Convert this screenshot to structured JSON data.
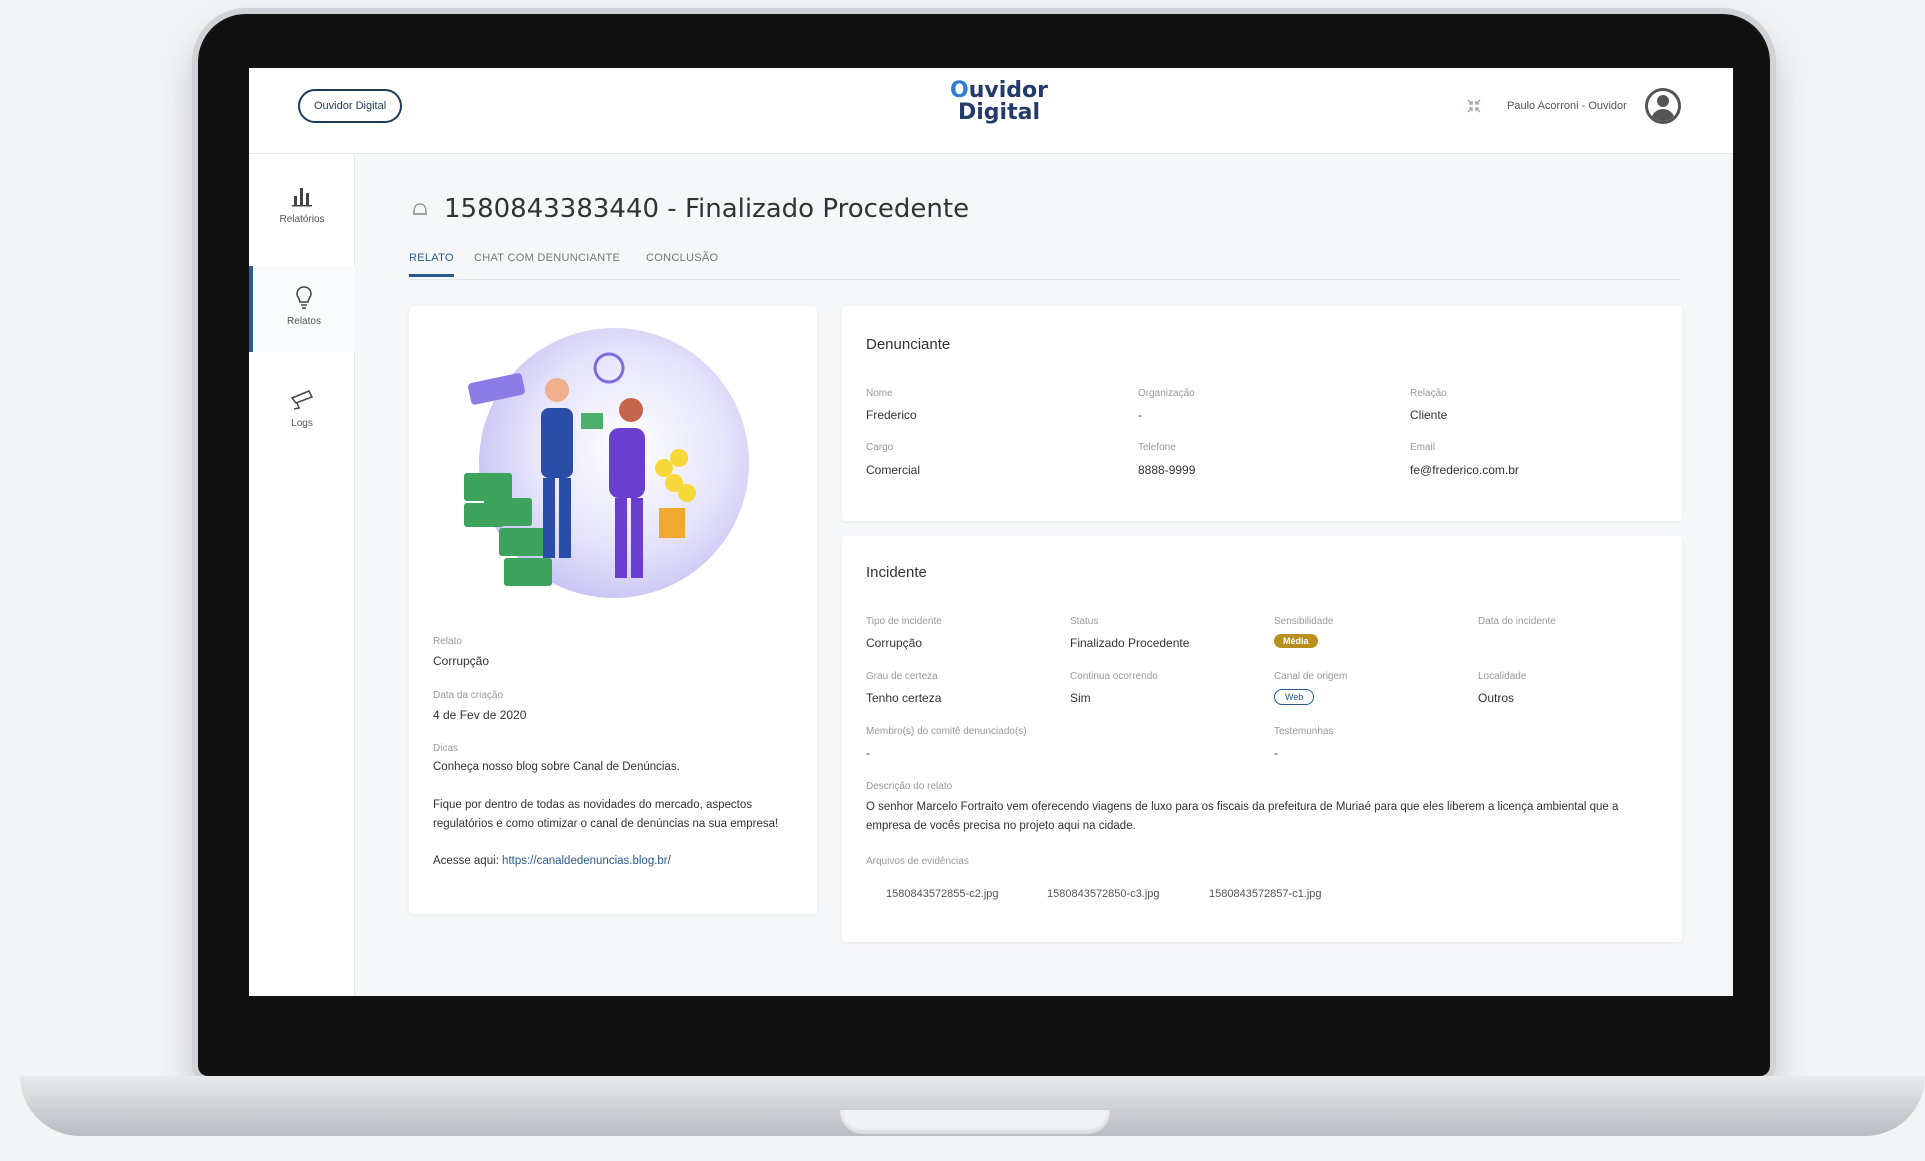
{
  "header": {
    "brand_pill": "Ouvidor Digital",
    "logo_line1_o": "O",
    "logo_line1_rest": "uvidor",
    "logo_line2": "Digital",
    "user": "Paulo Acorroni - Ouvidor"
  },
  "sidebar": {
    "items": [
      {
        "label": "Relatórios",
        "icon": "bar-chart-icon"
      },
      {
        "label": "Relatos",
        "icon": "lightbulb-icon"
      },
      {
        "label": "Logs",
        "icon": "camera-icon"
      }
    ]
  },
  "page": {
    "title": "1580843383440 - Finalizado Procedente",
    "tabs": [
      "RELATO",
      "CHAT COM DENUNCIANTE",
      "CONCLUSÃO"
    ]
  },
  "left_card": {
    "relato_label": "Relato",
    "relato_value": "Corrupção",
    "data_label": "Data da criação",
    "data_value": "4 de Fev de 2020",
    "dicas_label": "Dicas",
    "dicas_line1": "Conheça nosso blog sobre Canal de Denúncias.",
    "dicas_line2": "Fique por dentro de todas as novidades do mercado, aspectos",
    "dicas_line3": "regulatórios e como otimizar o canal de denúncias na sua empresa!",
    "access_prefix": "Acesse aqui: ",
    "access_link": "https://canaldedenuncias.blog.br/"
  },
  "denunciante": {
    "title": "Denunciante",
    "nome_label": "Nome",
    "nome": "Frederico",
    "org_label": "Organização",
    "org": "-",
    "relacao_label": "Relação",
    "relacao": "Cliente",
    "cargo_label": "Cargo",
    "cargo": "Comercial",
    "telefone_label": "Telefone",
    "telefone": "8888-9999",
    "email_label": "Email",
    "email": "fe@frederico.com.br"
  },
  "incidente": {
    "title": "Incidente",
    "tipo_label": "Tipo de incidente",
    "tipo": "Corrupção",
    "status_label": "Status",
    "status": "Finalizado Procedente",
    "sens_label": "Sensibilidade",
    "sens": "Média",
    "data_label": "Data do incidente",
    "grau_label": "Grau de certeza",
    "grau": "Tenho certeza",
    "continua_label": "Continua ocorrendo",
    "continua": "Sim",
    "canal_label": "Canal de origem",
    "canal": "Web",
    "local_label": "Localidade",
    "local": "Outros",
    "membros_label": "Membro(s) do comitê denunciado(s)",
    "membros": "-",
    "test_label": "Testemunhas",
    "test": "-",
    "desc_label": "Descrição do relato",
    "desc_line1": "O senhor Marcelo Fortraito vem oferecendo viagens de luxo para os fiscais da prefeitura de Muriaé para que eles liberem a licença ambiental que a",
    "desc_line2": "empresa de vocês precisa no projeto aqui na cidade.",
    "arquivos_label": "Arquivos de evidências",
    "files": [
      "1580843572855-c2.jpg",
      "1580843572850-c3.jpg",
      "1580843572857-c1.jpg"
    ]
  },
  "colors": {
    "accent": "#2a5a8f",
    "badge_gold": "#b88f1c"
  }
}
